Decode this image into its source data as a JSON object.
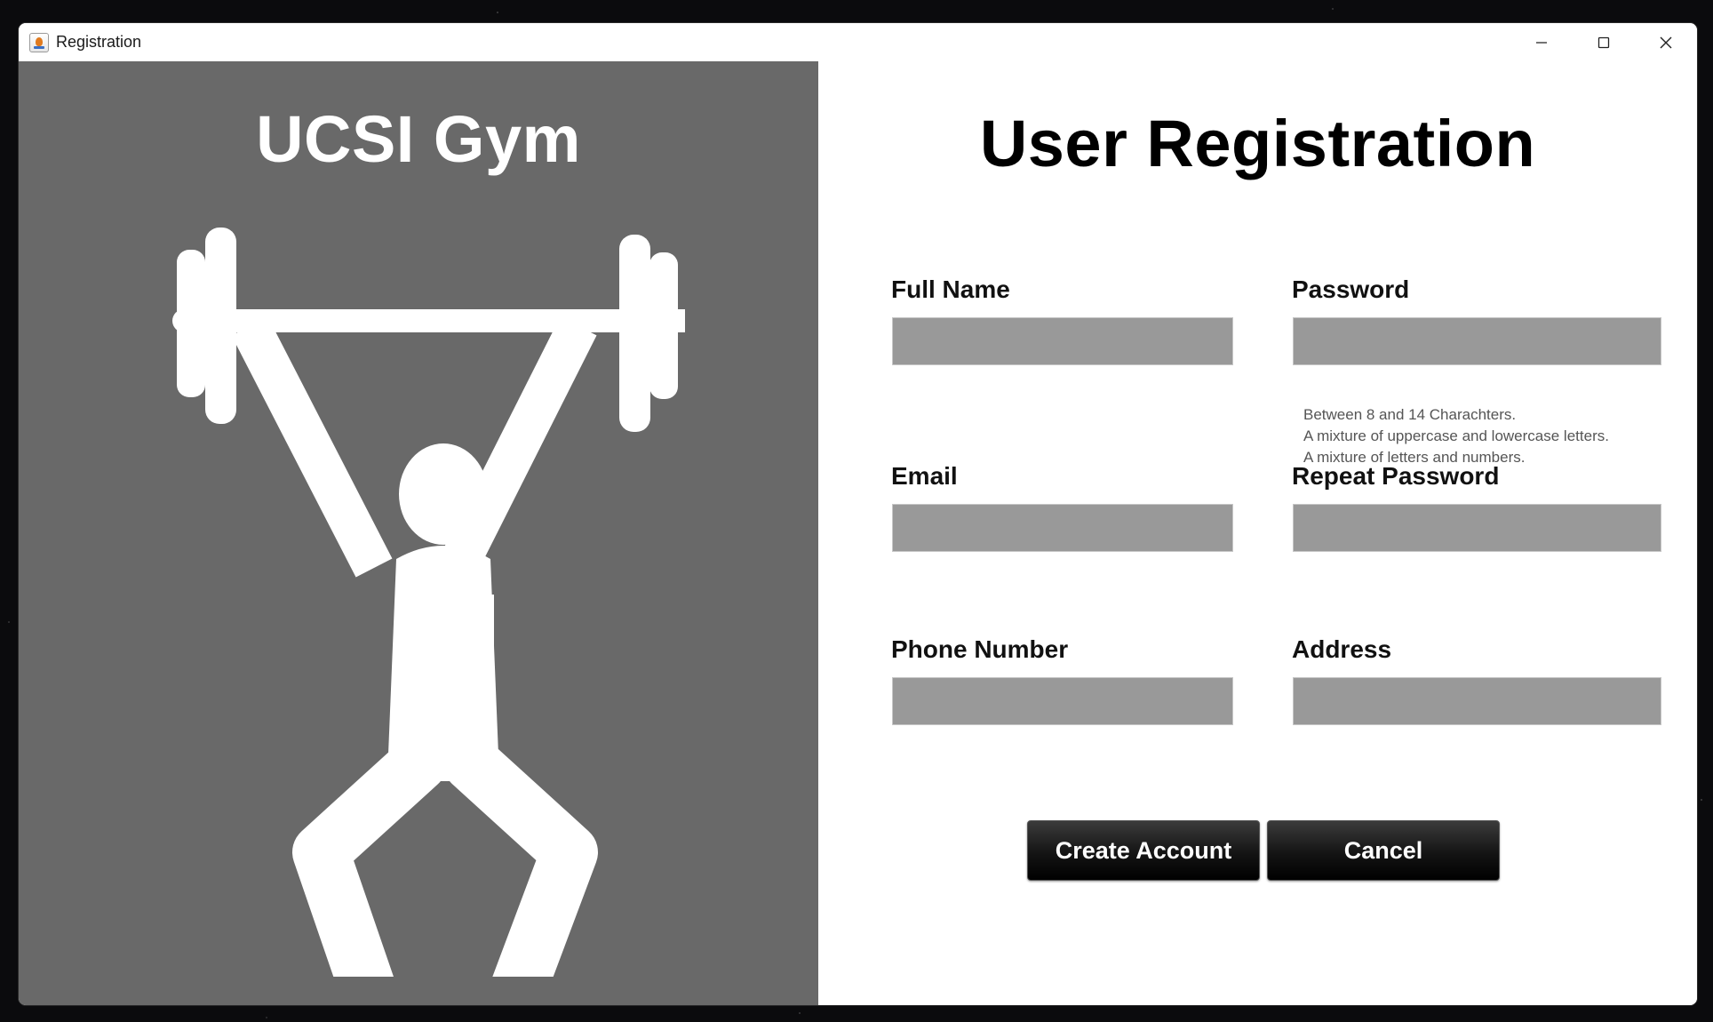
{
  "window": {
    "title": "Registration"
  },
  "branding": {
    "gym_name": "UCSI Gym",
    "illustration_icon": "weightlifter-icon"
  },
  "form": {
    "heading": "User Registration",
    "fields": {
      "full_name": {
        "label": "Full Name",
        "value": ""
      },
      "password": {
        "label": "Password",
        "value": ""
      },
      "email": {
        "label": "Email",
        "value": ""
      },
      "repeat_password": {
        "label": "Repeat Password",
        "value": ""
      },
      "phone_number": {
        "label": "Phone Number",
        "value": ""
      },
      "address": {
        "label": "Address",
        "value": ""
      }
    },
    "password_hints": [
      "Between 8 and 14 Charachters.",
      "A mixture of uppercase and lowercase letters.",
      "A mixture of letters and numbers."
    ],
    "buttons": {
      "create_account": "Create Account",
      "cancel": "Cancel"
    }
  },
  "colors": {
    "left_panel": "#696969",
    "field_background": "#999999",
    "button_background": "#1a1a1a"
  }
}
